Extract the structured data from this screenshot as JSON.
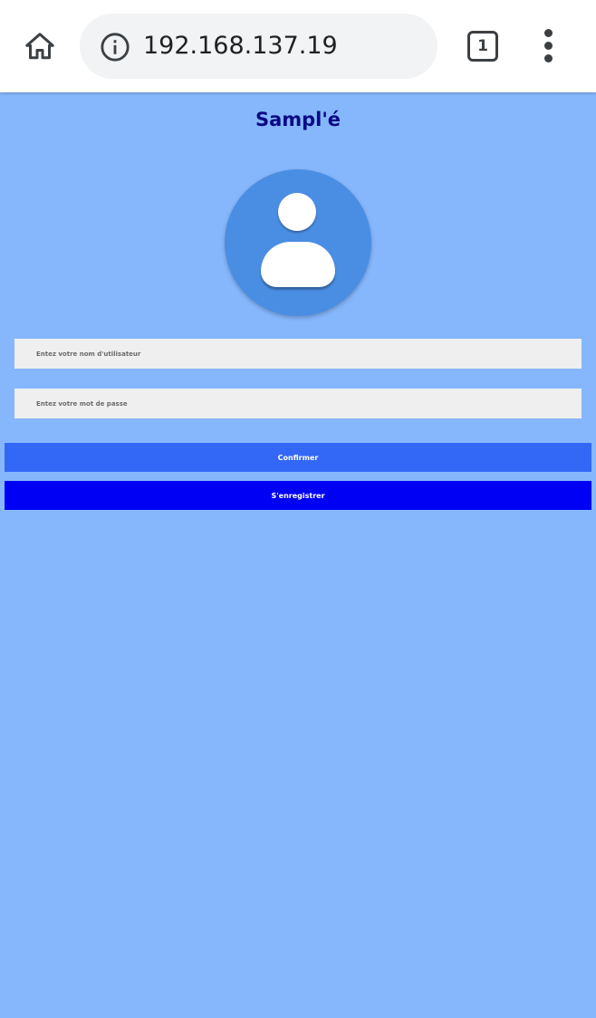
{
  "browser": {
    "url": "192.168.137.19",
    "tab_count": "1",
    "home_icon": "home-icon",
    "info_icon": "info-icon",
    "menu_icon": "more-vert-icon"
  },
  "page": {
    "title": "Sampl'é",
    "avatar_icon": "user-avatar-icon",
    "username_placeholder": "Entez votre nom d'utilisateur",
    "password_placeholder": "Entez votre mot de passe",
    "confirm_label": "Confirmer",
    "register_label": "S'enregistrer"
  },
  "colors": {
    "background": "#86b7fd",
    "title": "#0a0a85",
    "avatar": "#4a8ee3",
    "confirm_button": "#3368f7",
    "register_button": "#0000f5"
  }
}
